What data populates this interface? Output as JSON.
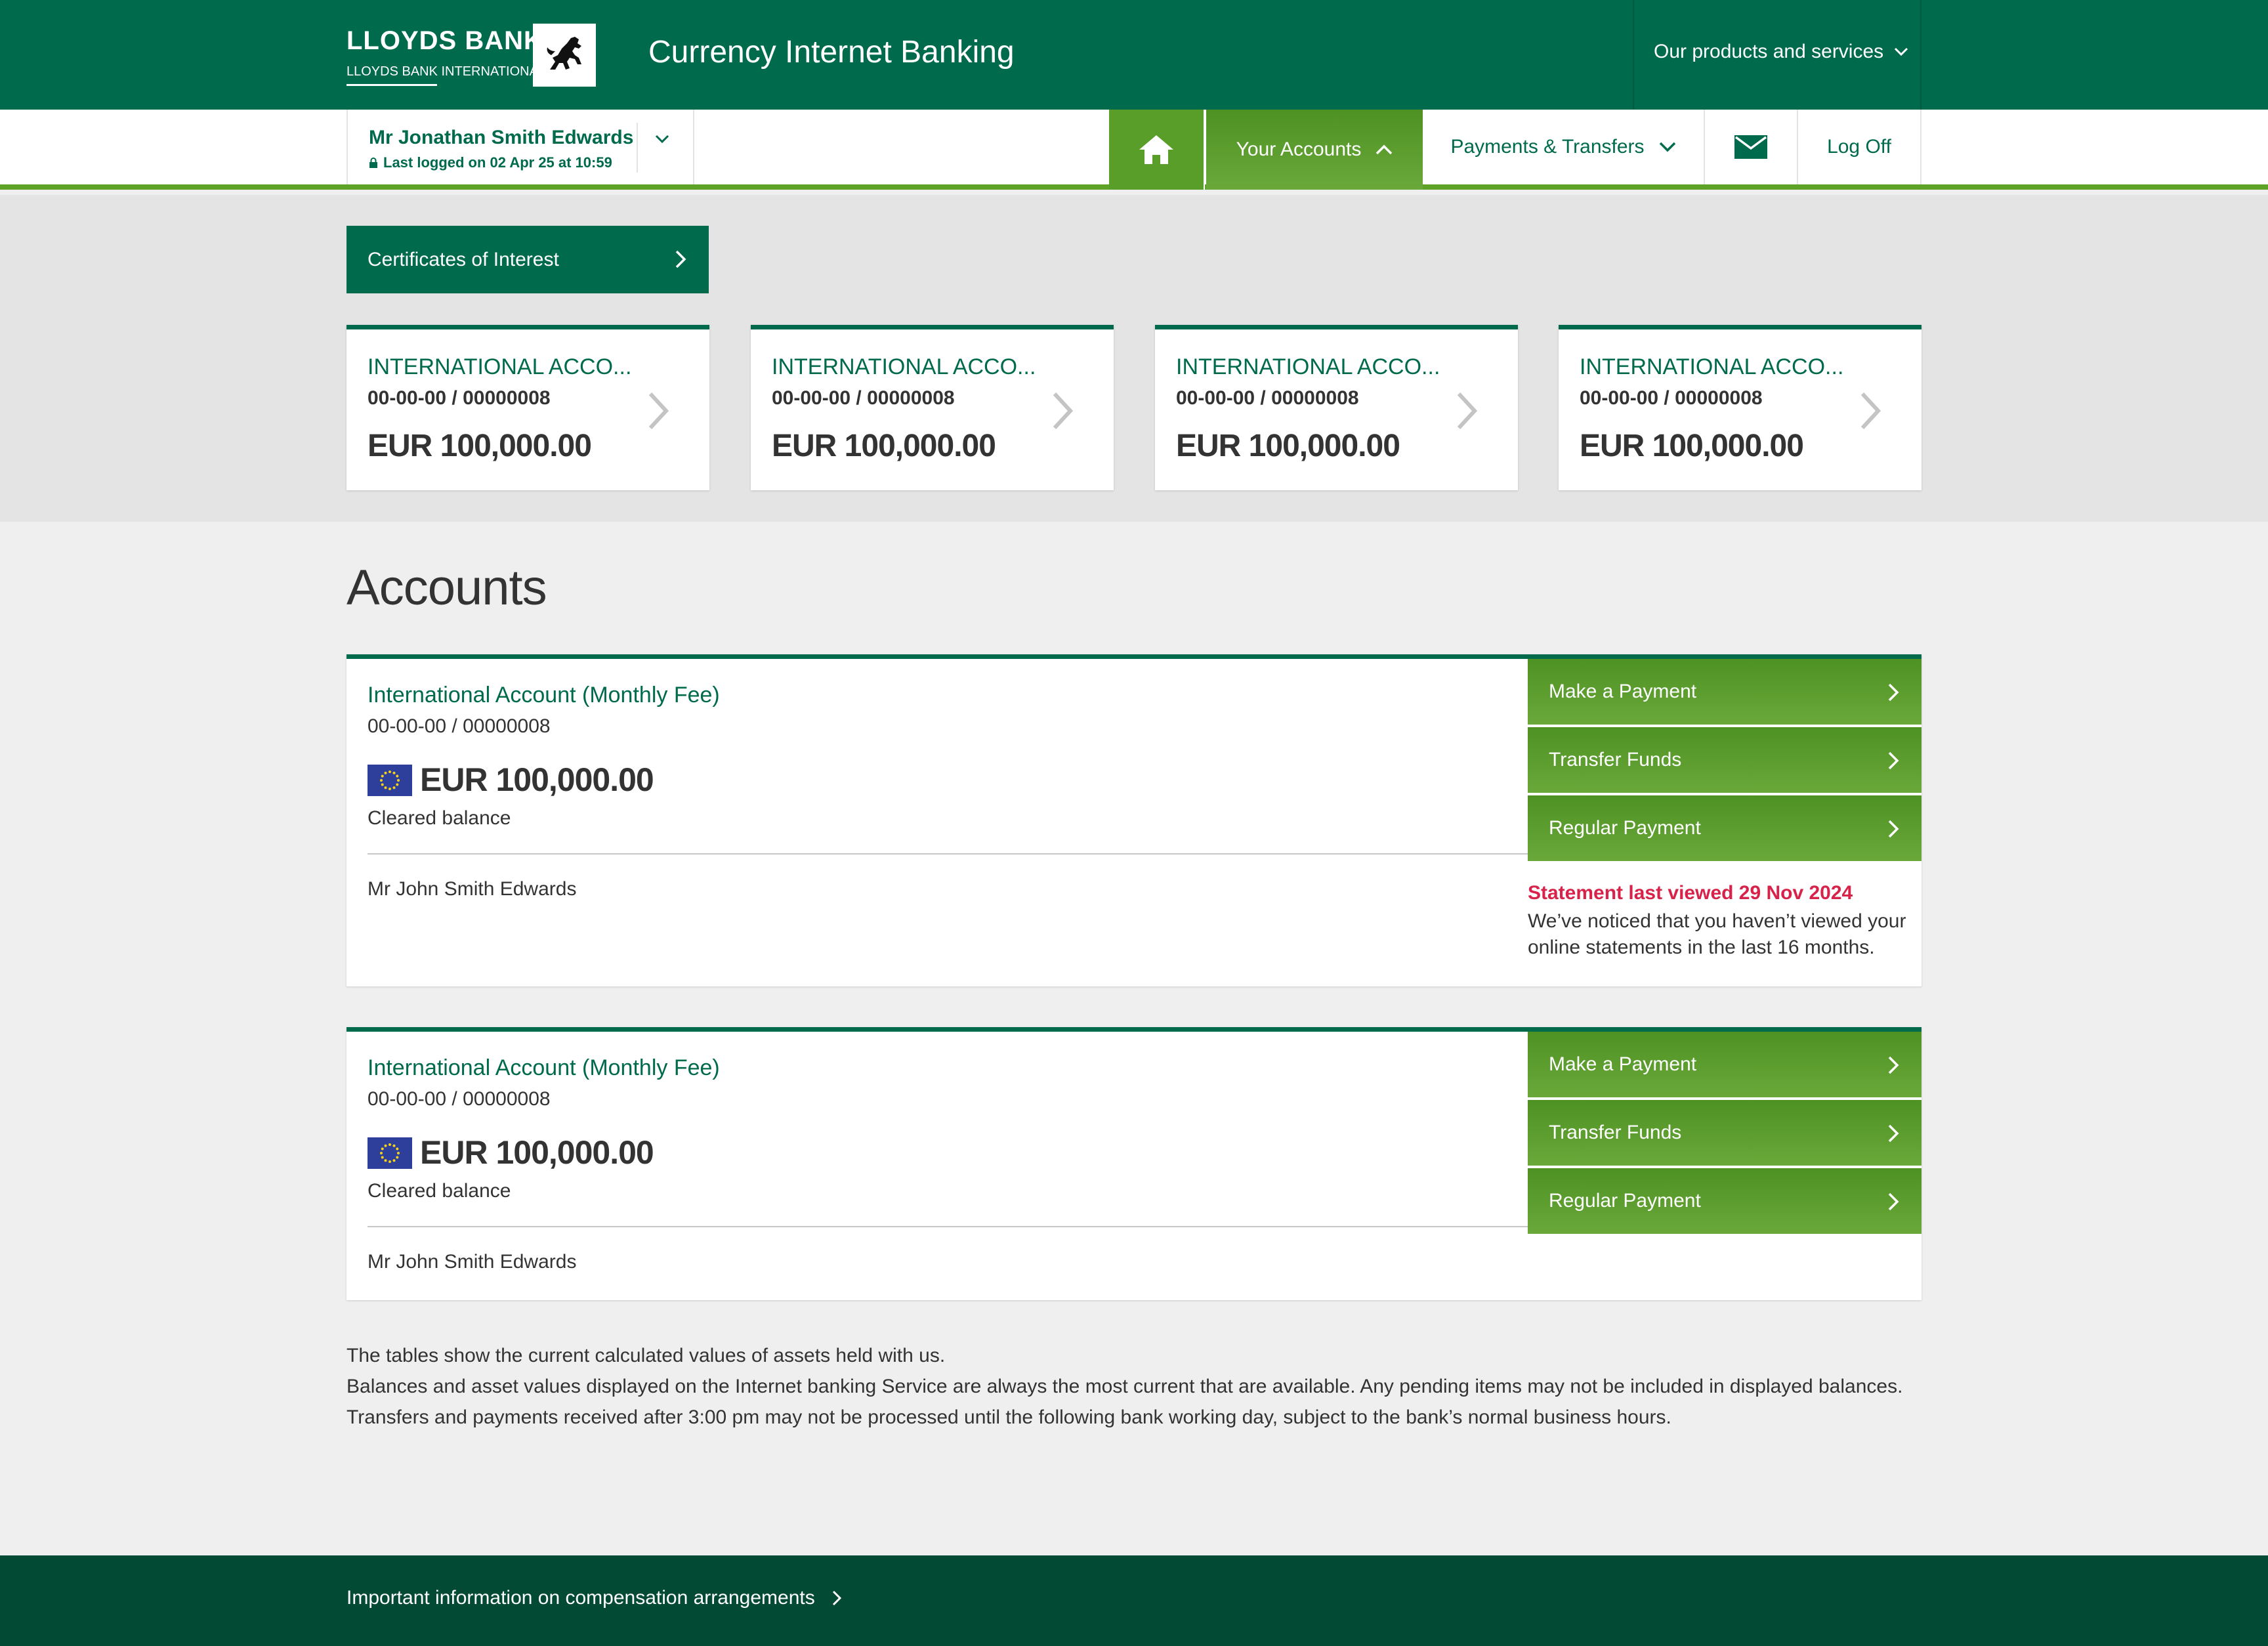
{
  "header": {
    "brand_name": "LLOYDS BANK",
    "brand_sub": "LLOYDS BANK INTERNATIONAL",
    "app_title": "Currency Internet Banking",
    "products_menu": "Our products and services"
  },
  "user": {
    "name": "Mr Jonathan Smith Edwards",
    "last_logged": "Last logged on 02 Apr 25 at 10:59"
  },
  "nav": {
    "your_accounts": "Your Accounts",
    "payments": "Payments & Transfers",
    "log_off": "Log Off"
  },
  "certificates_button": "Certificates of Interest",
  "account_cards": [
    {
      "name": "INTERNATIONAL ACCO...",
      "number": "00-00-00  /  00000008",
      "balance": "EUR 100,000.00"
    },
    {
      "name": "INTERNATIONAL ACCO...",
      "number": "00-00-00  /  00000008",
      "balance": "EUR 100,000.00"
    },
    {
      "name": "INTERNATIONAL ACCO...",
      "number": "00-00-00  /  00000008",
      "balance": "EUR 100,000.00"
    },
    {
      "name": "INTERNATIONAL ACCO...",
      "number": "00-00-00  /  00000008",
      "balance": "EUR 100,000.00"
    }
  ],
  "accounts_title": "Accounts",
  "accounts": [
    {
      "name": "International Account (Monthly Fee)",
      "number": "00-00-00  /  00000008",
      "balance": "EUR 100,000.00",
      "balance_label": "Cleared balance",
      "owner": "Mr John Smith Edwards",
      "actions": [
        "Make a Payment",
        "Transfer Funds",
        "Regular Payment"
      ],
      "statement_title": "Statement last viewed 29 Nov 2024",
      "statement_text": "We’ve noticed that you haven’t viewed your online statements in the last 16 months."
    },
    {
      "name": "International Account (Monthly Fee)",
      "number": "00-00-00  /  00000008",
      "balance": "EUR 100,000.00",
      "balance_label": "Cleared balance",
      "owner": "Mr John Smith Edwards",
      "actions": [
        "Make a Payment",
        "Transfer Funds",
        "Regular Payment"
      ]
    }
  ],
  "footnotes": [
    "The tables show the current calculated values of assets held with us.",
    "Balances and asset values displayed on the Internet banking Service are always the most current that are available. Any pending items may not be included in displayed balances.",
    "Transfers and payments received after 3:00 pm may not be processed until the following bank working day, subject to the bank’s normal business hours."
  ],
  "footer": {
    "compensation_link": "Important information on compensation arrangements"
  },
  "colors": {
    "brand_green": "#006a4d",
    "action_green": "#5ea228",
    "footer_green": "#024a34",
    "alert_red": "#d7234a",
    "eu_blue": "#2d3f9a"
  }
}
